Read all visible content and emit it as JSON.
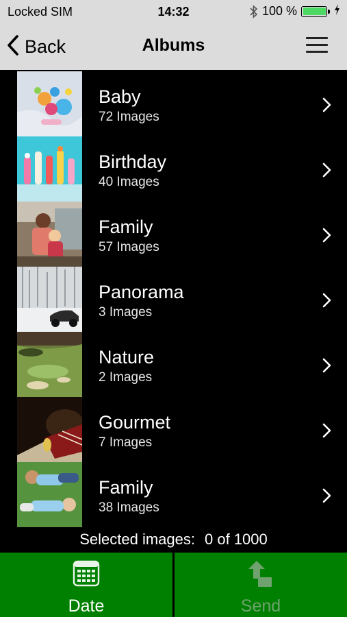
{
  "status_bar": {
    "carrier": "Locked SIM",
    "time": "14:32",
    "battery_text": "100 %",
    "battery_level": 1.0
  },
  "nav": {
    "back_label": "Back",
    "title": "Albums"
  },
  "albums": [
    {
      "name": "Baby",
      "count": "72 Images"
    },
    {
      "name": "Birthday",
      "count": "40 Images"
    },
    {
      "name": "Family",
      "count": "57 Images"
    },
    {
      "name": "Panorama",
      "count": "3 Images"
    },
    {
      "name": "Nature",
      "count": "2 Images"
    },
    {
      "name": "Gourmet",
      "count": "7 Images"
    },
    {
      "name": "Family",
      "count": "38 Images"
    }
  ],
  "selection": {
    "label": "Selected images:",
    "value": "0 of 1000"
  },
  "bottom_bar": {
    "date_label": "Date",
    "send_label": "Send"
  },
  "colors": {
    "header_bg": "#dcdcdc",
    "button_green": "#008000",
    "battery_green": "#4cd964"
  },
  "icons": {
    "back": "chevron-left-icon",
    "menu": "hamburger-menu-icon",
    "row": "chevron-right-icon",
    "date": "calendar-icon",
    "send": "upload-icon",
    "bluetooth": "bluetooth-icon",
    "battery": "battery-icon",
    "charging": "lightning-icon"
  }
}
